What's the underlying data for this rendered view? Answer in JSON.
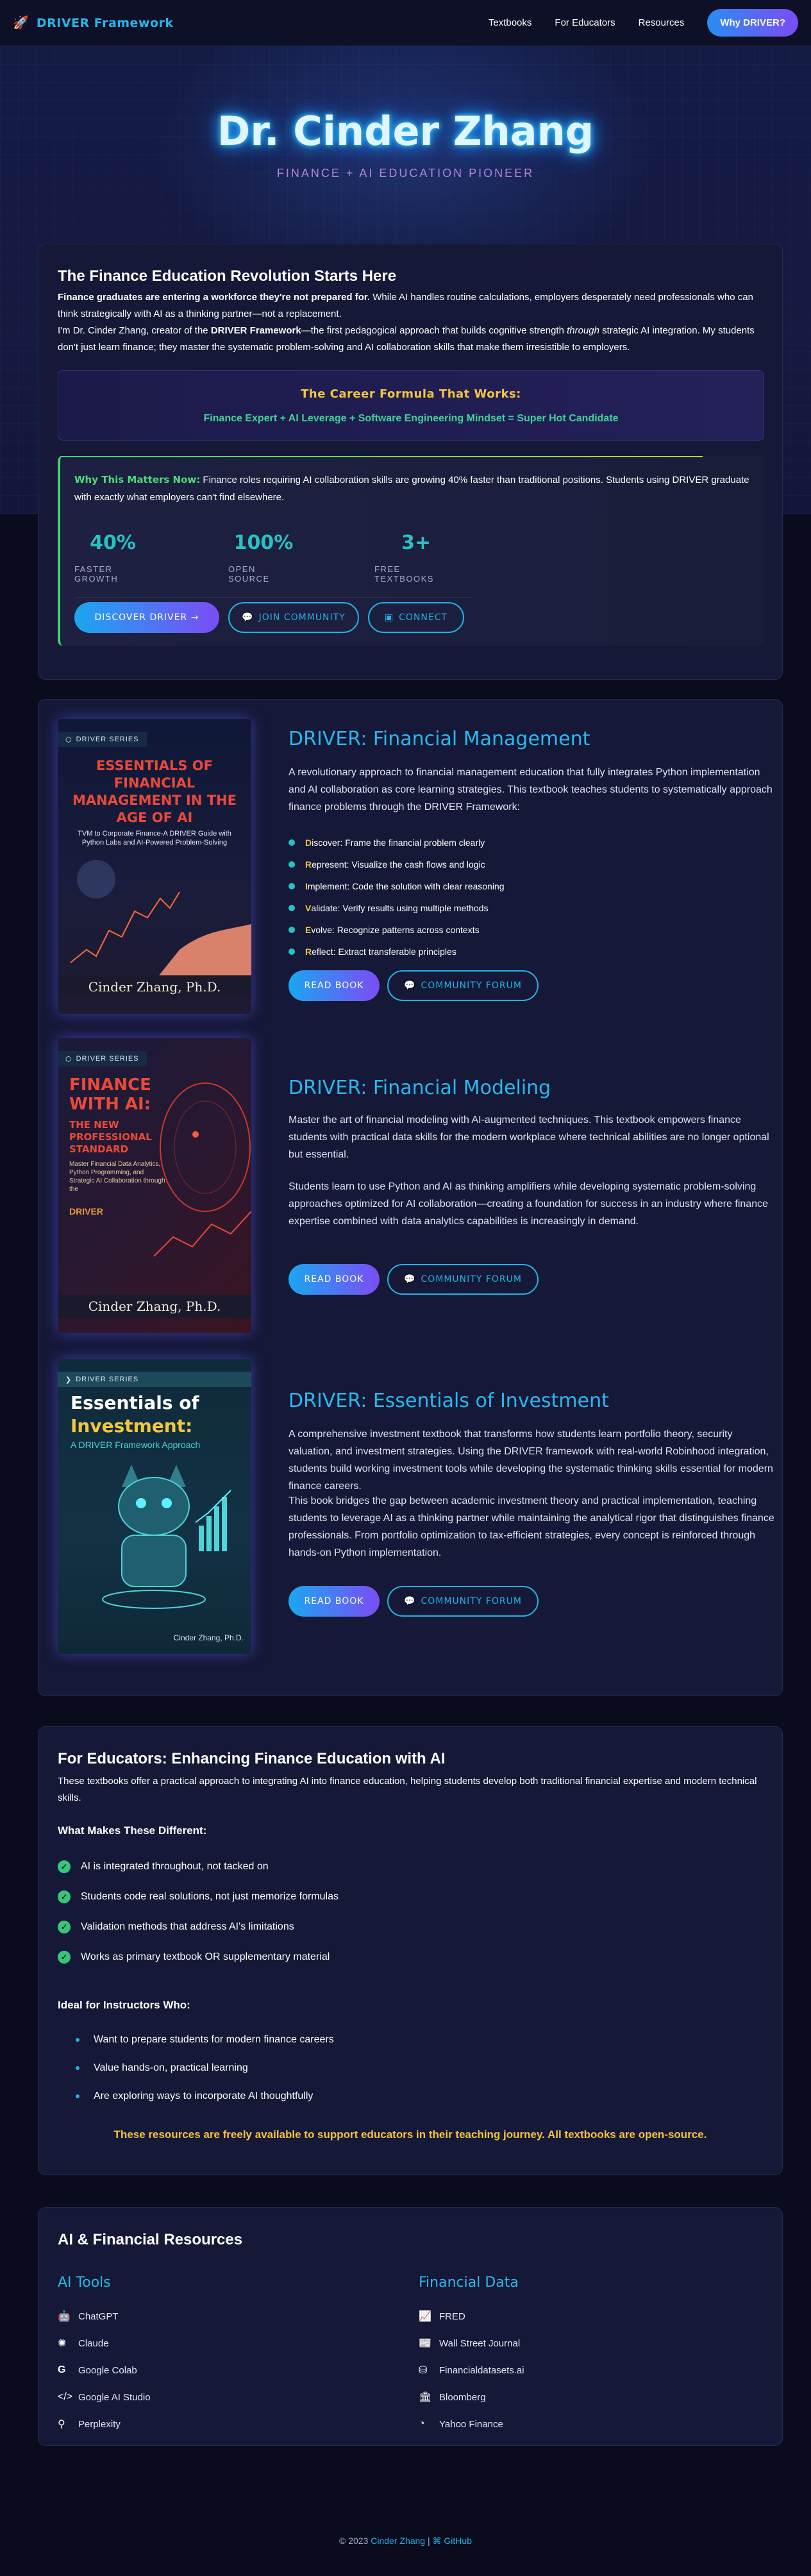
{
  "nav": {
    "brand": "DRIVER Framework",
    "links": [
      "Textbooks",
      "For Educators",
      "Resources"
    ],
    "cta": "Why DRIVER?"
  },
  "hero": {
    "title": "Dr. Cinder Zhang",
    "subtitle": "FINANCE + AI EDUCATION PIONEER"
  },
  "intro": {
    "title": "The Finance Education Revolution Starts Here",
    "p1_bold": "Finance graduates are entering a workforce they're not prepared for.",
    "p1_rest": " While AI handles routine calculations, employers desperately need professionals who can think strategically with AI as a thinking partner—not a replacement.",
    "p2_a": "I'm Dr. Cinder Zhang, creator of the ",
    "p2_bold": "DRIVER Framework",
    "p2_b": "—the first pedagogical approach that builds cognitive strength ",
    "p2_italic": "through",
    "p2_c": " strategic AI integration. My students don't just learn finance; they master the systematic problem-solving and AI collaboration skills that make them irresistible to employers.",
    "formula_title": "The Career Formula That Works:",
    "formula_text": "Finance Expert + AI Leverage + Software Engineering Mindset = Super Hot Candidate",
    "why_label": "Why This Matters Now:",
    "why_text": " Finance roles requiring AI collaboration skills are growing 40% faster than traditional positions. Students using DRIVER graduate with exactly what employers can't find elsewhere.",
    "stats": [
      {
        "num": "40%",
        "label": "FASTER GROWTH"
      },
      {
        "num": "100%",
        "label": "OPEN SOURCE"
      },
      {
        "num": "3+",
        "label": "FREE TEXTBOOKS"
      }
    ],
    "btn_discover": "DISCOVER DRIVER →",
    "btn_join": "JOIN COMMUNITY",
    "btn_connect": "CONNECT"
  },
  "books": [
    {
      "series": "DRIVER SERIES",
      "cover_title": "ESSENTIALS OF FINANCIAL MANAGEMENT IN THE AGE OF AI",
      "cover_sub": "TVM to Corporate Finance-A DRIVER Guide with Python Labs and AI-Powered Problem-Solving",
      "cover_author": "Cinder Zhang, Ph.D.",
      "title": "DRIVER: Financial Management",
      "p1": "A revolutionary approach to financial management education that fully integrates Python implementation and AI collaboration as core learning strategies. This textbook teaches students to systematically approach finance problems through the DRIVER Framework:",
      "driver": [
        {
          "letter": "D",
          "text": "iscover: Frame the financial problem clearly"
        },
        {
          "letter": "R",
          "text": "epresent: Visualize the cash flows and logic"
        },
        {
          "letter": "I",
          "text": "mplement: Code the solution with clear reasoning"
        },
        {
          "letter": "V",
          "text": "alidate: Verify results using multiple methods"
        },
        {
          "letter": "E",
          "text": "volve: Recognize patterns across contexts"
        },
        {
          "letter": "R",
          "text": "eflect: Extract transferable principles"
        }
      ],
      "btn_read": "READ BOOK",
      "btn_forum": "COMMUNITY FORUM"
    },
    {
      "series": "DRIVER SERIES",
      "cover_title": "FINANCE WITH AI:",
      "cover_title2": "THE NEW PROFESSIONAL STANDARD",
      "cover_sub": "Master Financial Data Analytics, Python Programming, and Strategic AI Collaboration through the",
      "cover_driver": "DRIVER",
      "cover_author": "Cinder Zhang, Ph.D.",
      "title": "DRIVER: Financial Modeling",
      "p1": "Master the art of financial modeling with AI-augmented techniques. This textbook empowers finance students with practical data skills for the modern workplace where technical abilities are no longer optional but essential.",
      "p2": "Students learn to use Python and AI as thinking amplifiers while developing systematic problem-solving approaches optimized for AI collaboration—creating a foundation for success in an industry where finance expertise combined with data analytics capabilities is increasingly in demand.",
      "btn_read": "READ BOOK",
      "btn_forum": "COMMUNITY FORUM"
    },
    {
      "series": "DRIVER SERIES",
      "cover_title": "Essentials of",
      "cover_title2": "Investment:",
      "cover_sub": "A DRIVER Framework Approach",
      "cover_author": "Cinder Zhang, Ph.D.",
      "title": "DRIVER: Essentials of Investment",
      "p1": "A comprehensive investment textbook that transforms how students learn portfolio theory, security valuation, and investment strategies. Using the DRIVER framework with real-world Robinhood integration, students build working investment tools while developing the systematic thinking skills essential for modern finance careers.",
      "p2": "This book bridges the gap between academic investment theory and practical implementation, teaching students to leverage AI as a thinking partner while maintaining the analytical rigor that distinguishes finance professionals. From portfolio optimization to tax-efficient strategies, every concept is reinforced through hands-on Python implementation.",
      "btn_read": "READ BOOK",
      "btn_forum": "COMMUNITY FORUM"
    }
  ],
  "educators": {
    "title": "For Educators: Enhancing Finance Education with AI",
    "p": "These textbooks offer a practical approach to integrating AI into finance education, helping students develop both traditional financial expertise and modern technical skills.",
    "h1": "What Makes These Different:",
    "checks": [
      "AI is integrated throughout, not tacked on",
      "Students code real solutions, not just memorize formulas",
      "Validation methods that address AI's limitations",
      "Works as primary textbook OR supplementary material"
    ],
    "h2": "Ideal for Instructors Who:",
    "bullets": [
      "Want to prepare students for modern finance careers",
      "Value hands-on, practical learning",
      "Are exploring ways to incorporate AI thoughtfully"
    ],
    "note": "These resources are freely available to support educators in their teaching journey. All textbooks are open-source."
  },
  "resources": {
    "title": "AI & Financial Resources",
    "ai_title": "AI Tools",
    "ai_tools": [
      {
        "icon": "robot-icon",
        "label": "ChatGPT"
      },
      {
        "icon": "brain-icon",
        "label": "Claude"
      },
      {
        "icon": "google-icon",
        "label": "Google Colab"
      },
      {
        "icon": "code-icon",
        "label": "Google AI Studio"
      },
      {
        "icon": "search-icon",
        "label": "Perplexity"
      }
    ],
    "data_title": "Financial Data",
    "data_sources": [
      {
        "icon": "line-chart-icon",
        "label": "FRED"
      },
      {
        "icon": "newspaper-icon",
        "label": "Wall Street Journal"
      },
      {
        "icon": "database-icon",
        "label": "Financialdatasets.ai"
      },
      {
        "icon": "bank-icon",
        "label": "Bloomberg"
      },
      {
        "icon": "pie-chart-icon",
        "label": "Yahoo Finance"
      }
    ]
  },
  "footer": {
    "prefix": "© 2023 ",
    "name": "Cinder Zhang",
    "sep": " | ",
    "github": "GitHub"
  }
}
